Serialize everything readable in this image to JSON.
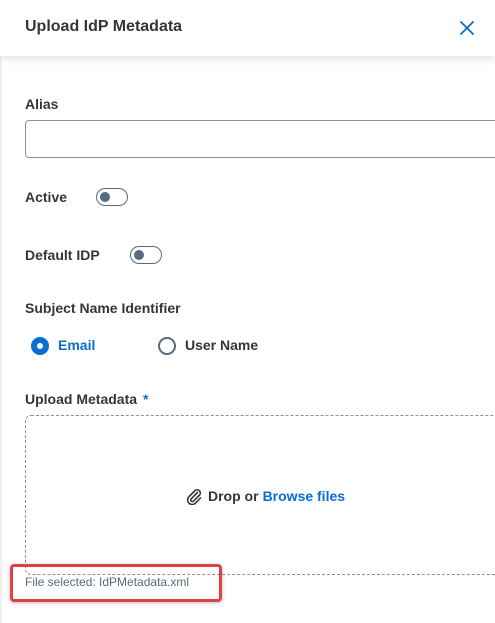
{
  "dialog": {
    "title": "Upload IdP Metadata",
    "close_icon": "close-icon"
  },
  "form": {
    "alias": {
      "label": "Alias",
      "value": "",
      "placeholder": ""
    },
    "active": {
      "label": "Active",
      "checked": false
    },
    "default_idp": {
      "label": "Default IDP",
      "checked": false
    },
    "subject_name_identifier": {
      "label": "Subject Name Identifier",
      "options": [
        {
          "label": "Email",
          "selected": true
        },
        {
          "label": "User Name",
          "selected": false
        }
      ]
    },
    "upload_metadata": {
      "label": "Upload Metadata",
      "required_marker": "*",
      "drop_text": "Drop or",
      "browse_text": "Browse files",
      "icon": "paperclip-icon",
      "file_selected": "File selected: IdPMetadata.xml"
    }
  },
  "colors": {
    "accent": "#0a6ed1",
    "highlight": "#e0403f",
    "text": "#32363a"
  }
}
